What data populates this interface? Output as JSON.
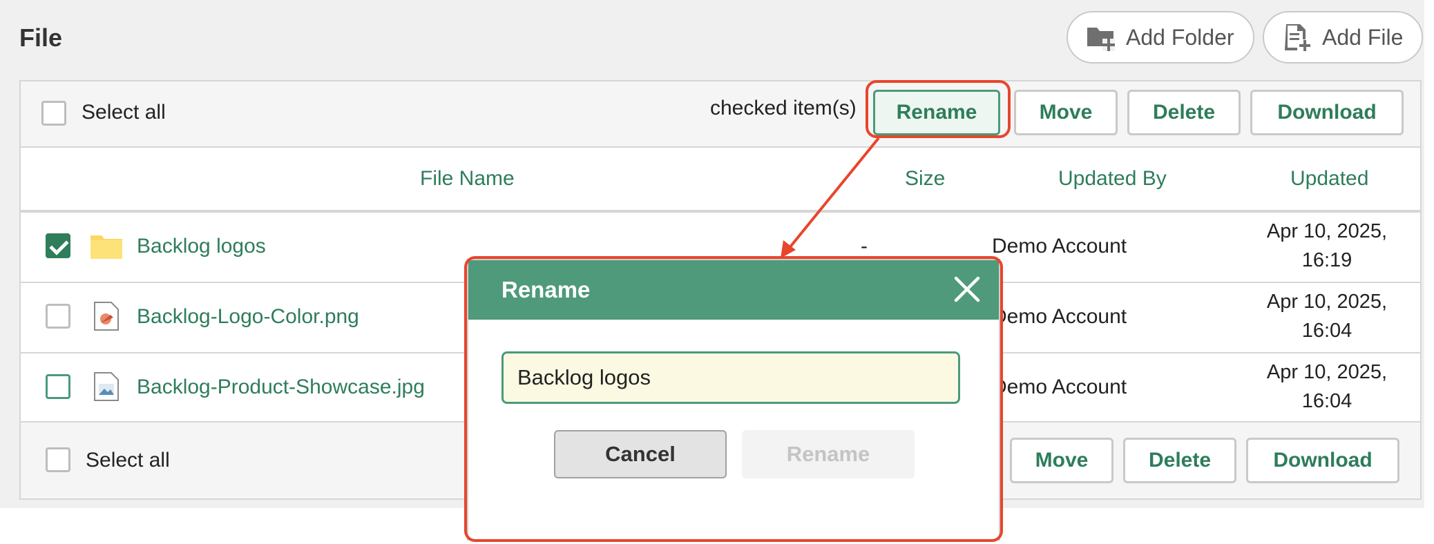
{
  "page": {
    "title": "File"
  },
  "header_actions": [
    {
      "label": "Add Folder",
      "icon": "folder-plus-icon"
    },
    {
      "label": "Add File",
      "icon": "file-plus-icon"
    }
  ],
  "toolbar": {
    "select_all": "Select all",
    "checked_items": "checked item(s)",
    "actions": [
      "Rename",
      "Move",
      "Delete",
      "Download"
    ]
  },
  "table": {
    "columns": [
      "File Name",
      "Size",
      "Updated By",
      "Updated"
    ],
    "rows": [
      {
        "name": "Backlog logos",
        "type": "folder",
        "size": "-",
        "updated_by": "Demo Account",
        "updated_date": "Apr 10, 2025,",
        "updated_time": "16:19",
        "checked": true
      },
      {
        "name": "Backlog-Logo-Color.png",
        "type": "image",
        "size": "",
        "updated_by": "Demo Account",
        "updated_date": "Apr 10, 2025,",
        "updated_time": "16:04",
        "checked": false
      },
      {
        "name": "Backlog-Product-Showcase.jpg",
        "type": "image",
        "size": "",
        "updated_by": "Demo Account",
        "updated_date": "Apr 10, 2025,",
        "updated_time": "16:04",
        "checked": false
      }
    ]
  },
  "bottombar": {
    "select_all": "Select all",
    "actions": [
      "Move",
      "Delete",
      "Download"
    ]
  },
  "dialog": {
    "title": "Rename",
    "input_value": "Backlog logos",
    "cancel": "Cancel",
    "confirm": "Rename"
  },
  "colors": {
    "accent": "#2e7d5b",
    "dialog_header": "#4f9a7b",
    "annotation": "#e8452c",
    "input_bg": "#fbf9e2"
  }
}
